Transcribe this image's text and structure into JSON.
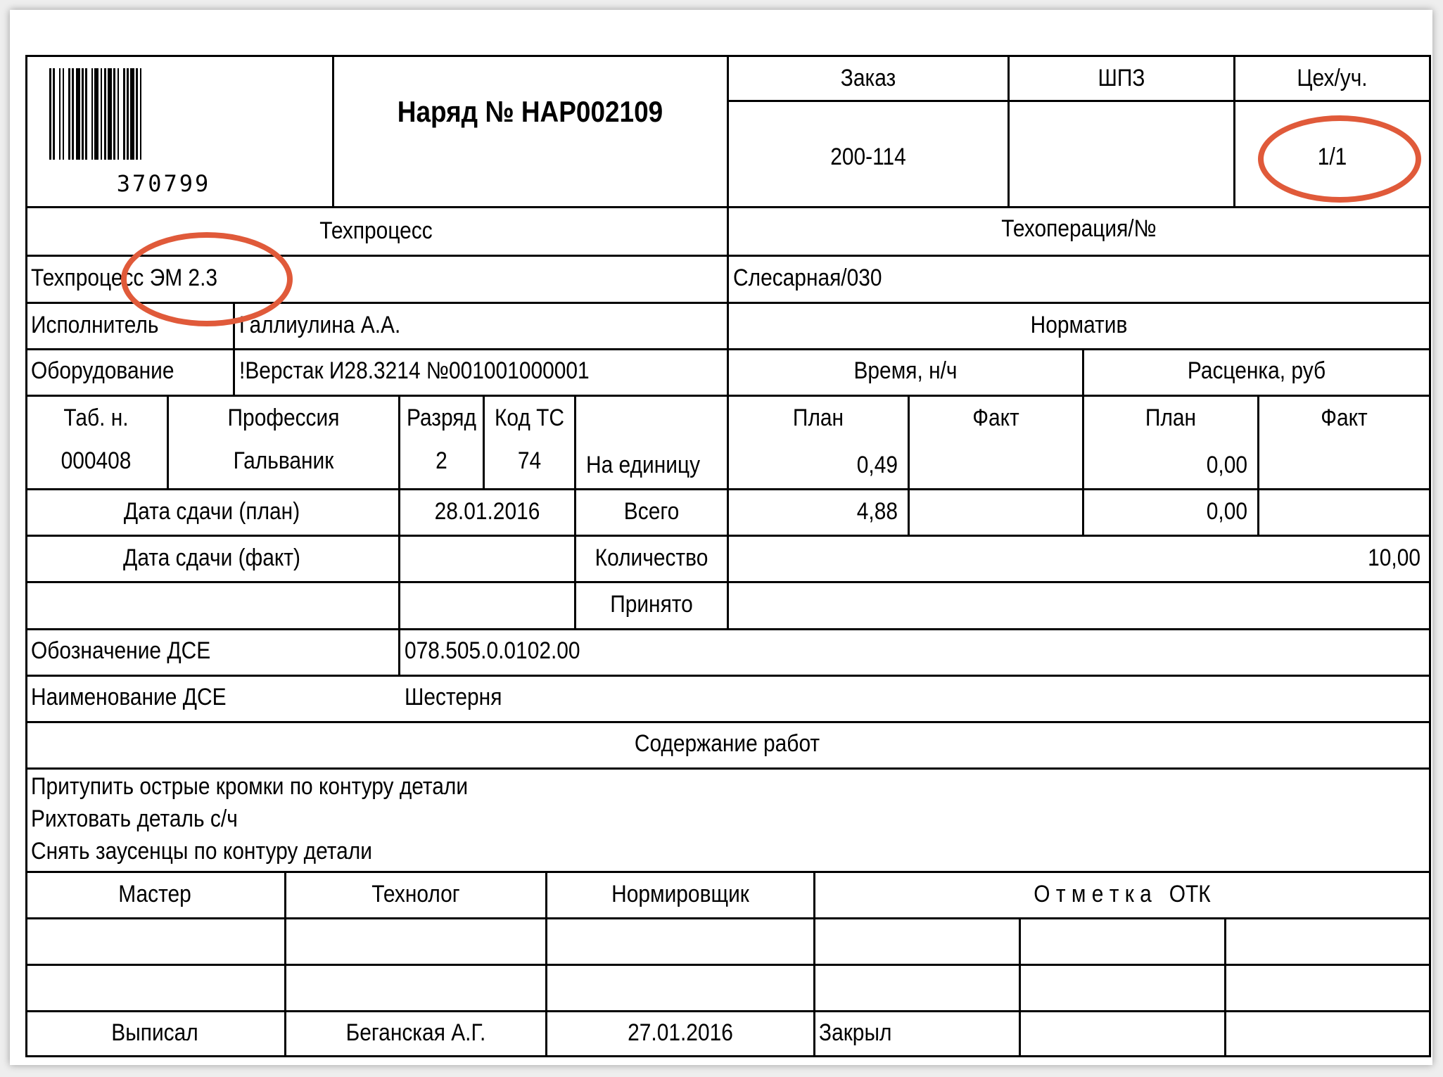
{
  "header": {
    "barcode_number": "370799",
    "title": "Наряд № НАР002109",
    "order_label": "Заказ",
    "order_value": "200-114",
    "shpz_label": "ШПЗ",
    "shpz_value": "",
    "shop_label": "Цех/уч.",
    "shop_value": "1/1"
  },
  "process": {
    "techprocess_label": "Техпроцесс",
    "techprocess_value": "Техпроцесс ЭМ 2.3",
    "operation_label": "Техоперация/№",
    "operation_value": "Слесарная/030",
    "executor_label": "Исполнитель",
    "executor_value": "Галлиулина А.А.",
    "equipment_label": "Оборудование",
    "equipment_value": "!Верстак И28.3214 №001001000001"
  },
  "norm": {
    "title": "Норматив",
    "time_label": "Время, н/ч",
    "rate_label": "Расценка, руб",
    "plan_label": "План",
    "fact_label": "Факт",
    "per_unit_label": "На единицу",
    "time_plan_unit": "0,49",
    "rate_plan_unit": "0,00",
    "total_label": "Всего",
    "time_plan_total": "4,88",
    "rate_plan_total": "0,00",
    "quantity_label": "Количество",
    "quantity_value": "10,00",
    "accepted_label": "Принято"
  },
  "worker": {
    "tab_label": "Таб. н.",
    "profession_label": "Профессия",
    "grade_label": "Разряд",
    "code_label": "Код ТС",
    "tab_value": "000408",
    "profession_value": "Гальваник",
    "grade_value": "2",
    "code_value": "74"
  },
  "dates": {
    "plan_label": "Дата сдачи (план)",
    "plan_value": "28.01.2016",
    "fact_label": "Дата сдачи (факт)",
    "fact_value": ""
  },
  "part": {
    "designation_label": "Обозначение ДСЕ",
    "designation_value": "078.505.0.0102.00",
    "name_label": "Наименование ДСЕ",
    "name_value": "Шестерня"
  },
  "work": {
    "title": "Содержание работ",
    "lines": [
      "Притупить острые кромки по контуру детали",
      "Рихтовать деталь с/ч",
      "Снять заусенцы по контуру детали"
    ]
  },
  "signatures": {
    "master_label": "Мастер",
    "technologist_label": "Технолог",
    "normer_label": "Нормировщик",
    "otk_label": "О т м е т к а   ОТК",
    "issued_label": "Выписал",
    "issued_by": "Беганская А.Г.",
    "issued_date": "27.01.2016",
    "closed_label": "Закрыл"
  },
  "annotations": {
    "ring_color": "#e05a3a"
  }
}
